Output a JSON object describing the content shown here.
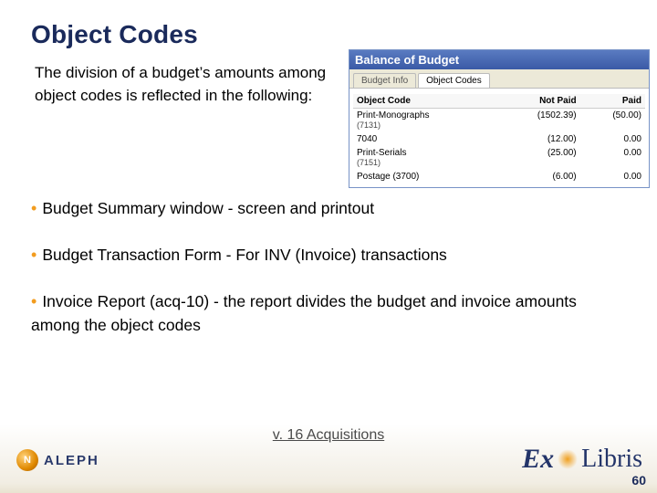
{
  "title": "Object Codes",
  "intro": "The division of a budget’s amounts among object codes is reflected in the following:",
  "bullets": [
    "Budget Summary window - screen and printout",
    "Budget Transaction Form - For INV (Invoice) transactions",
    "Invoice Report (acq-10) - the report divides the budget and invoice amounts among the object codes"
  ],
  "footer_center": "v. 16 Acquisitions",
  "page_number": "60",
  "logos": {
    "aleph_text": "ALEPH",
    "aleph_orb_letter": "N",
    "exlibris_ex": "Ex",
    "exlibris_libris": "Libris"
  },
  "screenshot": {
    "window_title": "Balance of Budget",
    "tabs": {
      "t1": "Budget Info",
      "t2": "Object Codes"
    },
    "headers": {
      "c1": "Object Code",
      "c2": "Not Paid",
      "c3": "Paid"
    },
    "rows": [
      {
        "name": "Print-Monographs",
        "sub": "(7131)",
        "notpaid": "(1502.39)",
        "paid": "(50.00)"
      },
      {
        "name": "7040",
        "sub": "",
        "notpaid": "(12.00)",
        "paid": "0.00"
      },
      {
        "name": "Print-Serials",
        "sub": "(7151)",
        "notpaid": "(25.00)",
        "paid": "0.00"
      },
      {
        "name": "Postage (3700)",
        "sub": "",
        "notpaid": "(6.00)",
        "paid": "0.00"
      }
    ]
  }
}
